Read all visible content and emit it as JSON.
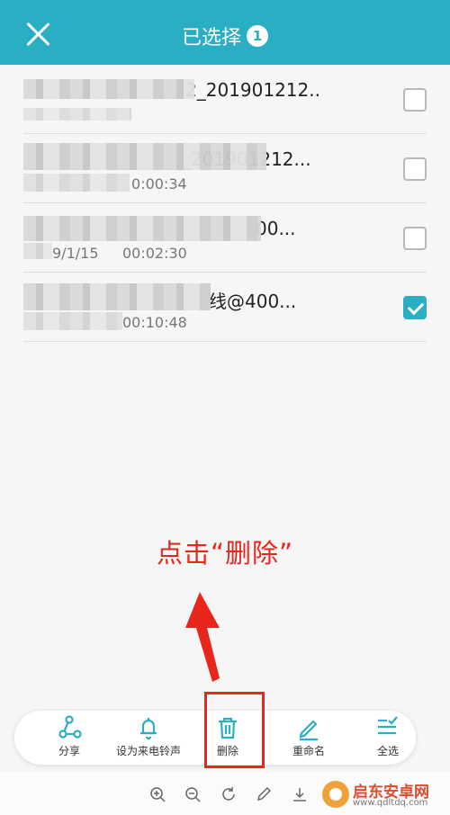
{
  "header": {
    "title": "已选择",
    "selected_count": "1"
  },
  "files": [
    {
      "name": "2_201901212...",
      "meta_left": "",
      "duration": "",
      "checked": false
    },
    {
      "name": "_201901212...",
      "meta_left": "",
      "duration": "0:00:34",
      "checked": false
    },
    {
      "name": "00...",
      "meta_left": "9/1/15",
      "duration": "00:02:30",
      "checked": false
    },
    {
      "name": "线@400...",
      "meta_left": "",
      "duration": "00:10:48",
      "checked": true
    }
  ],
  "annotation": {
    "text": "点击“删除”",
    "color": "#e8261b"
  },
  "toolbar": {
    "items": [
      {
        "label": "分享",
        "icon": "share-icon"
      },
      {
        "label": "设为来电铃声",
        "icon": "bell-icon"
      },
      {
        "label": "删除",
        "icon": "trash-icon"
      },
      {
        "label": "重命名",
        "icon": "pencil-icon"
      },
      {
        "label": "全选",
        "icon": "select-all-icon"
      }
    ]
  },
  "watermark": {
    "name": "启东安卓网",
    "url": "www.qdltdq.com"
  },
  "colors": {
    "accent": "#2aaec4",
    "annotation": "#e8261b"
  }
}
